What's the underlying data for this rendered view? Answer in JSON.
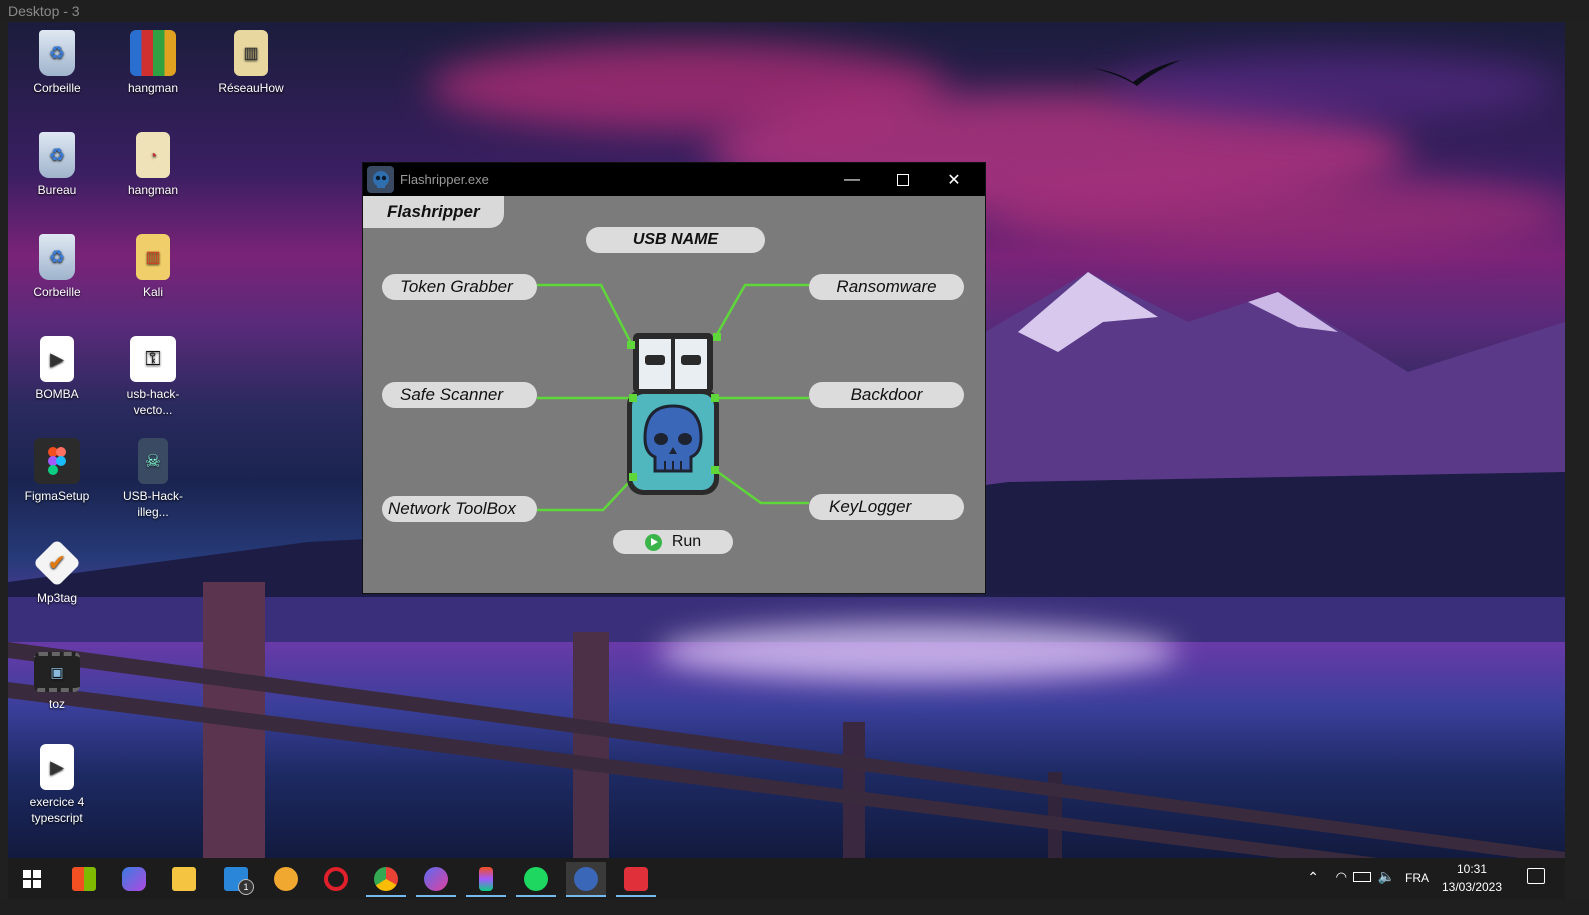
{
  "screen_title": "Desktop - 3",
  "desktop_icons": [
    {
      "label": "Corbeille",
      "icon": "recycle-bin-icon"
    },
    {
      "label": "hangman",
      "icon": "winrar-archive-icon"
    },
    {
      "label": "RéseauHow",
      "icon": "zip-folder-icon"
    },
    {
      "label": "Bureau",
      "icon": "recycle-bin-icon"
    },
    {
      "label": "hangman",
      "icon": "pdf-file-icon"
    },
    {
      "label": "Corbeille",
      "icon": "recycle-bin-icon"
    },
    {
      "label": "Kali",
      "icon": "zip-folder-icon"
    },
    {
      "label": "BOMBA",
      "icon": "video-file-icon"
    },
    {
      "label": "usb-hack-vecto...",
      "icon": "usb-image-icon"
    },
    {
      "label": "FigmaSetup",
      "icon": "figma-icon"
    },
    {
      "label": "USB-Hack-illeg...",
      "icon": "usb-skull-icon"
    },
    {
      "label": "Mp3tag",
      "icon": "mp3tag-icon"
    },
    {
      "label": "toz",
      "icon": "video-thumbnail-icon"
    },
    {
      "label": "exercice 4 typescript",
      "icon": "video-file-icon"
    }
  ],
  "window": {
    "title": "Flashripper.exe",
    "tab_label": "Flashripper",
    "usb_name": "USB NAME",
    "left_modules": [
      "Token Grabber",
      "Safe Scanner",
      "Network ToolBox"
    ],
    "right_modules": [
      "Ransomware",
      "Backdoor",
      "KeyLogger"
    ],
    "run_label": "Run",
    "accent": "#5fd63a"
  },
  "taskbar": {
    "apps": [
      "windows-start-icon",
      "store-icon",
      "bing-icon",
      "file-explorer-icon",
      "mail-icon",
      "discord-icon",
      "opera-icon",
      "chrome-icon",
      "messenger-icon",
      "figma-icon",
      "spotify-icon",
      "flashripper-icon",
      "app-icon"
    ],
    "mail_badge": "1",
    "language": "FRA",
    "time": "10:31",
    "date": "13/03/2023"
  }
}
